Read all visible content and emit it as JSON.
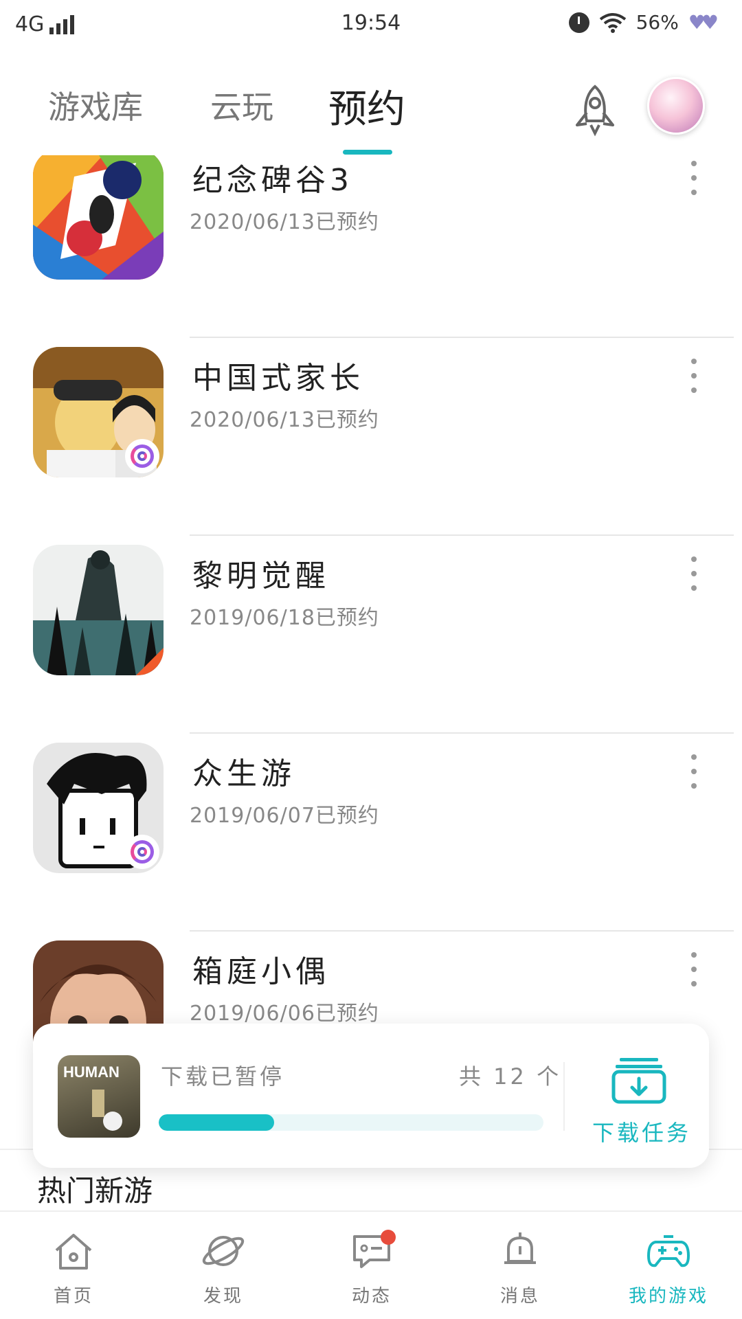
{
  "status_bar": {
    "network": "4G",
    "time": "19:54",
    "battery": "56%"
  },
  "header": {
    "tabs": [
      {
        "label": "游戏库"
      },
      {
        "label": "云玩"
      },
      {
        "label": "预约"
      }
    ],
    "active_tab": "预约"
  },
  "reservations": [
    {
      "name": "纪念碑谷3",
      "date": "2020/06/13已预约",
      "icon": "monument-valley-icon"
    },
    {
      "name": "中国式家长",
      "date": "2020/06/13已预约",
      "icon": "chinese-parents-icon"
    },
    {
      "name": "黎明觉醒",
      "date": "2019/06/18已预约",
      "icon": "lifeafter-dawn-icon"
    },
    {
      "name": "众生游",
      "date": "2019/06/07已预约",
      "icon": "cartoon-boy-icon"
    },
    {
      "name": "箱庭小偶",
      "date": "2019/06/06已预约",
      "icon": "doll-face-icon"
    }
  ],
  "download": {
    "status": "下载已暂停",
    "count": "共 12 个",
    "progress": 0.3,
    "task_label": "下载任务",
    "thumb_text": "HUMAN"
  },
  "section": {
    "title": "热门新游"
  },
  "bottom_nav": [
    {
      "label": "首页",
      "icon": "home-icon"
    },
    {
      "label": "发现",
      "icon": "planet-icon"
    },
    {
      "label": "动态",
      "icon": "chat-icon",
      "badge": true
    },
    {
      "label": "消息",
      "icon": "bell-icon"
    },
    {
      "label": "我的游戏",
      "icon": "gamepad-icon",
      "active": true
    }
  ],
  "colors": {
    "accent": "#19b7bf",
    "progress_fill": "#19c0c6",
    "badge_red": "#e74c3c"
  }
}
